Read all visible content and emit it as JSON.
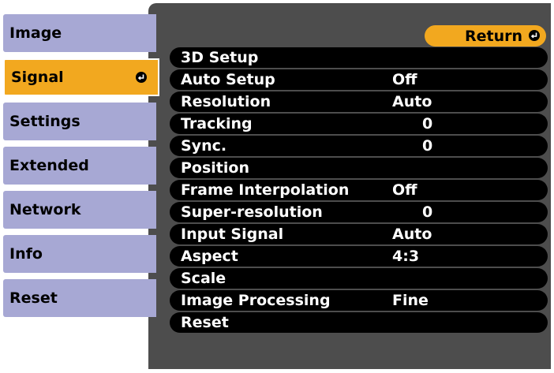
{
  "tabs": [
    {
      "label": "Image"
    },
    {
      "label": "Signal"
    },
    {
      "label": "Settings"
    },
    {
      "label": "Extended"
    },
    {
      "label": "Network"
    },
    {
      "label": "Info"
    },
    {
      "label": "Reset"
    }
  ],
  "active_tab": "Signal",
  "return_label": "Return",
  "rows": [
    {
      "label": "3D Setup",
      "value": ""
    },
    {
      "label": "Auto Setup",
      "value": "Off"
    },
    {
      "label": "Resolution",
      "value": "Auto"
    },
    {
      "label": "Tracking",
      "value": "0"
    },
    {
      "label": "Sync.",
      "value": "0"
    },
    {
      "label": "Position",
      "value": ""
    },
    {
      "label": "Frame Interpolation",
      "value": "Off"
    },
    {
      "label": "Super-resolution",
      "value": "0"
    },
    {
      "label": "Input Signal",
      "value": "Auto"
    },
    {
      "label": "Aspect",
      "value": "4:3"
    },
    {
      "label": "Scale",
      "value": ""
    },
    {
      "label": "Image Processing",
      "value": "Fine"
    },
    {
      "label": "Reset",
      "value": ""
    }
  ],
  "colors": {
    "tab_bg": "#a7a8d4",
    "accent": "#f2a81f",
    "panel_bg": "#4d4d4d",
    "row_bg": "#000000"
  },
  "icons": {
    "enter": "enter-icon"
  }
}
